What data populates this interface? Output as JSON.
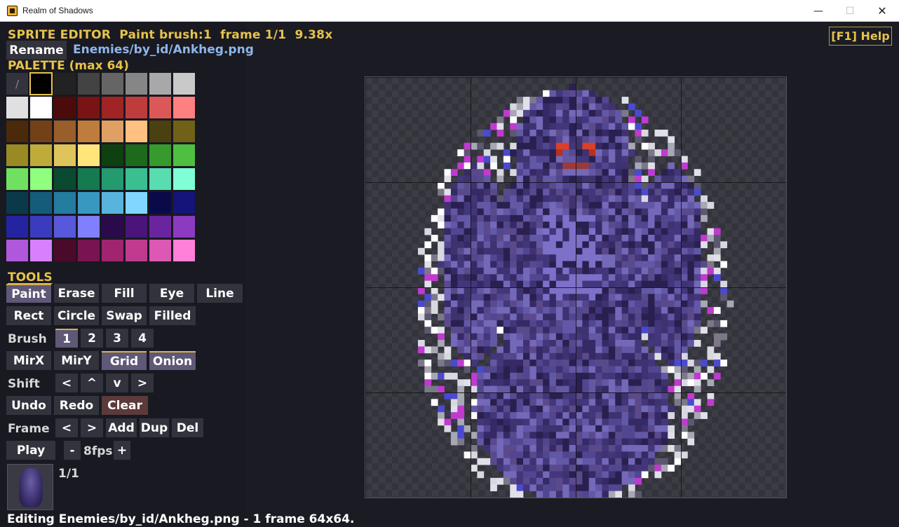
{
  "window": {
    "title": "Realm of Shadows",
    "minimize": "—",
    "maximize": "☐",
    "close": "✕"
  },
  "header": {
    "mode": "SPRITE EDITOR",
    "tool_info": "Paint",
    "brush_info": "brush:1",
    "frame_info": "frame 1/1",
    "zoom": "9.38x",
    "help": "[F1] Help",
    "rename": "Rename",
    "file_path": "Enemies/by_id/Ankheg.png"
  },
  "palette": {
    "title": "PALETTE (max 64)",
    "none_glyph": "/",
    "selected_index": 1,
    "colors": [
      "none",
      "#000000",
      "#222222",
      "#434343",
      "#656565",
      "#868686",
      "#a8a8a8",
      "#c9c9c9",
      "#e0e0e0",
      "#ffffff",
      "#4c0a0a",
      "#7a1414",
      "#a02424",
      "#c03b3b",
      "#dc5858",
      "#ff8080",
      "#4a2a0a",
      "#744018",
      "#9a5e2a",
      "#bf7c3d",
      "#dea063",
      "#ffc080",
      "#4a4010",
      "#706018",
      "#9a8a24",
      "#bfab3a",
      "#dec45a",
      "#ffe57a",
      "#0e4010",
      "#1d6a1c",
      "#369a2d",
      "#4fbf41",
      "#70e060",
      "#90ff80",
      "#0a4a30",
      "#167a50",
      "#239a70",
      "#39bf90",
      "#58dcb0",
      "#80ffd6",
      "#0a3a4a",
      "#145c7a",
      "#247ca0",
      "#3898c0",
      "#58b4dc",
      "#80d6ff",
      "#0a0a4a",
      "#14147a",
      "#2424a0",
      "#3b3bc0",
      "#5858dc",
      "#8080ff",
      "#2a0a4a",
      "#4a147a",
      "#6a24a0",
      "#8c3bc0",
      "#b058dc",
      "#d680ff",
      "#4a0a2a",
      "#7a1450",
      "#a02470",
      "#c03b90",
      "#dc58b4",
      "#ff80d6"
    ]
  },
  "tools": {
    "title": "TOOLS",
    "row1": [
      "Paint",
      "Erase",
      "Fill",
      "Eye",
      "Line"
    ],
    "row2": [
      "Rect",
      "Circle",
      "Swap",
      "Filled"
    ],
    "brush_label": "Brush",
    "brush_sizes": [
      "1",
      "2",
      "3",
      "4"
    ],
    "toggles": [
      "MirX",
      "MirY",
      "Grid",
      "Onion"
    ],
    "shift_label": "Shift",
    "shift_buttons": [
      "<",
      "^",
      "v",
      ">"
    ],
    "history": [
      "Undo",
      "Redo",
      "Clear"
    ],
    "frame_label": "Frame",
    "frame_buttons": [
      "<",
      ">",
      "Add",
      "Dup",
      "Del"
    ],
    "play": "Play",
    "fps_minus": "-",
    "fps": "8fps",
    "fps_plus": "+",
    "frame_count": "1/1"
  },
  "status": {
    "text": "Editing Enemies/by_id/Ankheg.png - 1 frame 64x64."
  },
  "canvas": {
    "pixel_count": 64,
    "grid_divisions": 4
  }
}
